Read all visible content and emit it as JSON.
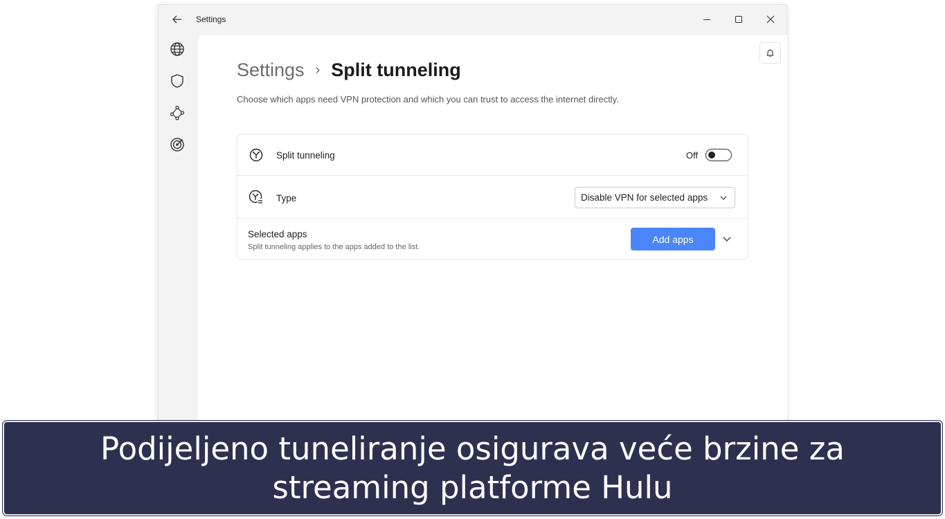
{
  "window": {
    "title": "Settings",
    "icons": {
      "back": "back-arrow-icon",
      "minimize": "minimize-icon",
      "maximize": "maximize-icon",
      "close": "close-icon"
    }
  },
  "sidebar": {
    "items": [
      {
        "icon": "globe-icon"
      },
      {
        "icon": "shield-icon"
      },
      {
        "icon": "network-nodes-icon"
      },
      {
        "icon": "target-icon"
      }
    ]
  },
  "header": {
    "breadcrumb_parent": "Settings",
    "breadcrumb_separator": "›",
    "breadcrumb_current": "Split tunneling",
    "description": "Choose which apps need VPN protection and which you can trust to access the internet directly.",
    "bell_icon": "bell-icon"
  },
  "settings": {
    "split_tunneling": {
      "label": "Split tunneling",
      "state_label": "Off",
      "enabled": false
    },
    "type": {
      "label": "Type",
      "selected": "Disable VPN for selected apps"
    },
    "selected_apps": {
      "title": "Selected apps",
      "subtitle": "Split tunneling applies to the apps added to the list.",
      "add_button": "Add apps"
    }
  },
  "caption": {
    "line1": "Podijeljeno tuneliranje osigurava veće brzine za",
    "line2": "streaming platforme Hulu"
  },
  "colors": {
    "accent": "#4a86f7",
    "caption_bg": "#2e3050"
  }
}
